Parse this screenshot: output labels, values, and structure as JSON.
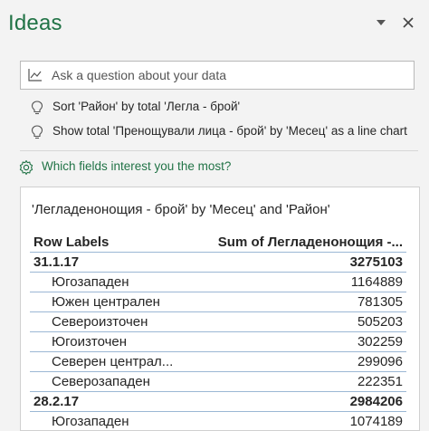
{
  "pane": {
    "title": "Ideas",
    "dropdown_icon": "chevron-down-icon",
    "close_icon": "close-icon"
  },
  "ask": {
    "placeholder": "Ask a question about your data",
    "icon": "chart-icon"
  },
  "suggestions": [
    {
      "text": "Sort 'Район' by total 'Легла - брой'",
      "icon": "lightbulb-icon"
    },
    {
      "text": "Show total 'Пренощували лица - брой' by 'Месец' as a line chart",
      "icon": "lightbulb-icon"
    }
  ],
  "fields_link": {
    "text": "Which fields interest you the most?",
    "icon": "gear-icon"
  },
  "card": {
    "title": "'Легладенонощия - брой' by 'Месец' and 'Район'",
    "table": {
      "headers": [
        "Row Labels",
        "Sum of Легладенонощия -..."
      ],
      "rows": [
        {
          "type": "group",
          "label": "31.1.17",
          "value": "3275103"
        },
        {
          "type": "item",
          "label": "Югозападен",
          "value": "1164889"
        },
        {
          "type": "item",
          "label": "Южен централен",
          "value": "781305"
        },
        {
          "type": "item",
          "label": "Североизточен",
          "value": "505203"
        },
        {
          "type": "item",
          "label": "Югоизточен",
          "value": "302259"
        },
        {
          "type": "item",
          "label": "Северен централ...",
          "value": "299096"
        },
        {
          "type": "item",
          "label": "Северозападен",
          "value": "222351"
        },
        {
          "type": "group",
          "label": "28.2.17",
          "value": "2984206"
        },
        {
          "type": "item",
          "label": "Югозападен",
          "value": "1074189"
        }
      ]
    }
  },
  "colors": {
    "accent": "#217346",
    "pane_bg": "#f3f3f3",
    "row_border": "#9bb7d4"
  }
}
